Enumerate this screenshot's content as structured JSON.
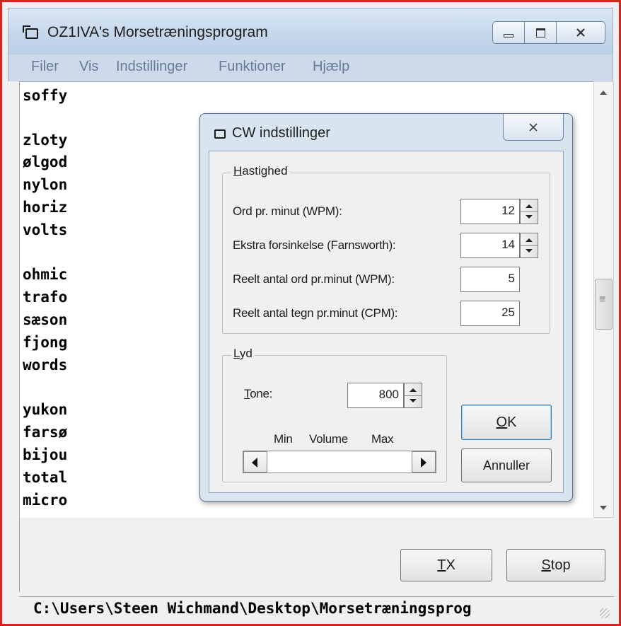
{
  "window": {
    "title": "OZ1IVA's Morsetræningsprogram"
  },
  "menu": [
    "Filer",
    "Vis",
    "Indstillinger",
    "Funktioner",
    "Hjælp"
  ],
  "words": [
    "soffy",
    "",
    "zloty",
    "ølgod",
    "nylon",
    "horiz",
    "volts",
    "",
    "ohmic",
    "trafo",
    "sæson",
    "fjong",
    "words",
    "",
    "yukon",
    "farsø",
    "bijou",
    "total",
    "micro"
  ],
  "buttons": {
    "tx_rest": "X",
    "tx_key": "T",
    "stop_rest": "top",
    "stop_key": "S"
  },
  "status": {
    "path": "C:\\Users\\Steen Wichmand\\Desktop\\Morsetræningsprog"
  },
  "dialog": {
    "title": "CW indstillinger",
    "hastighed": {
      "legend_key": "H",
      "legend_rest": "astighed",
      "wpm_label": "Ord pr. minut (WPM):",
      "wpm_value": "12",
      "farnsworth_label": "Ekstra forsinkelse (Farnsworth):",
      "farnsworth_value": "14",
      "real_wpm_label": "Reelt antal ord pr.minut (WPM):",
      "real_wpm_value": "5",
      "real_cpm_label": "Reelt antal tegn pr.minut (CPM):",
      "real_cpm_value": "25"
    },
    "lyd": {
      "legend_key": "L",
      "legend_rest": "yd",
      "tone_key": "T",
      "tone_rest": "one:",
      "tone_value": "800",
      "volume_min": "Min",
      "volume_label": "Volume",
      "volume_max": "Max",
      "volume_level": 0.0
    },
    "ok_key": "O",
    "ok_rest": "K",
    "cancel_label": "Annuller"
  },
  "icons": {
    "minimize": "minimize-icon",
    "maximize": "maximize-icon",
    "close": "close-icon"
  }
}
